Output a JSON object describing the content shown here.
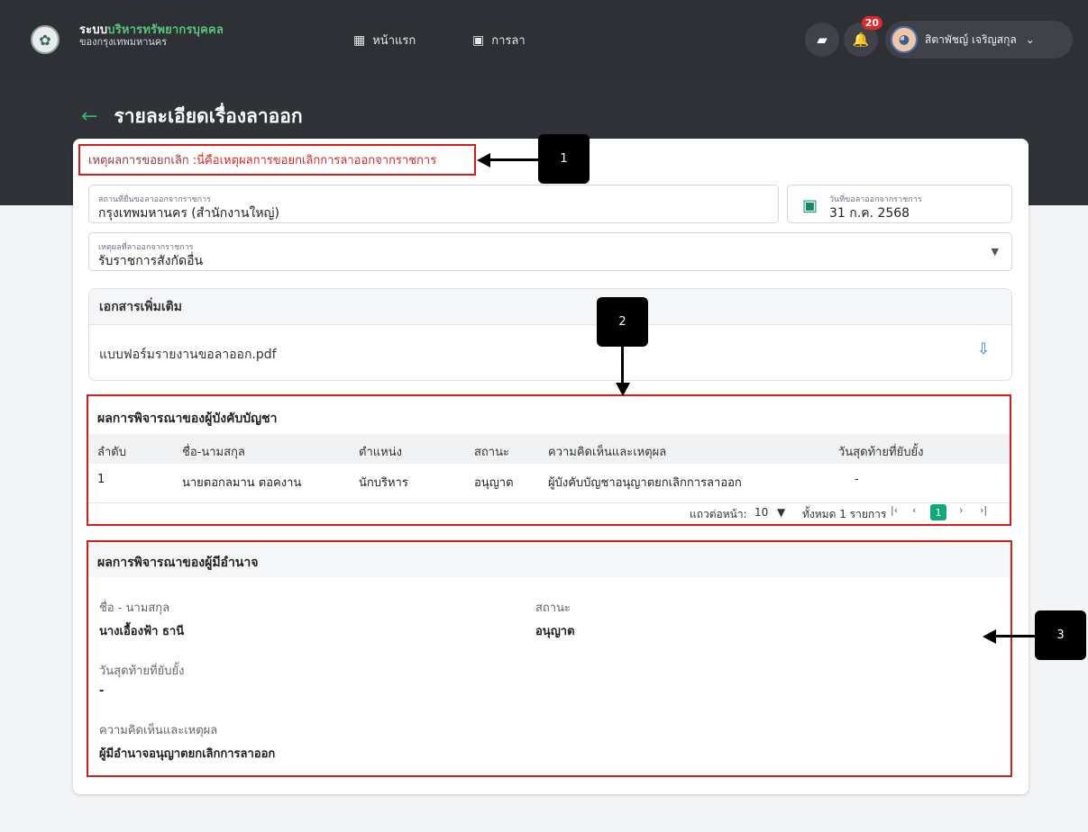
{
  "header": {
    "brand_line1_a": "ระบบ",
    "brand_line1_b": "บริหารทรัพยากรบุคคล",
    "brand_line2": "ของกรุงเทพมหานคร",
    "nav_home": "หน้าแรก",
    "nav_leave": "การลา",
    "notification_count": "20",
    "user_name": "สิตาพัชญ์ เจริญสกุล"
  },
  "page": {
    "title": "รายละเอียดเรื่องลาออก"
  },
  "cancel_reason": {
    "label": "เหตุผลการขอยกเลิก : ",
    "value": "นี่คือเหตุผลการขอยกเลิกการลาออกจากราชการ"
  },
  "fields": {
    "department_label": "สถานที่ยื่นขอลาออกจากราชการ",
    "department_value": "กรุงเทพมหานคร (สำนักงานใหญ่)",
    "date_label": "วันที่ขอลาออกจากราชการ",
    "date_value": "31 ก.ค. 2568",
    "reason_label": "เหตุผลที่ลาออกจากราชการ",
    "reason_value": "รับราชการสังกัดอื่น"
  },
  "documents": {
    "title": "เอกสารเพิ่มเติม",
    "file_name": "แบบฟอร์มรายงานขอลาออก.pdf"
  },
  "supervisor": {
    "title": "ผลการพิจารณาของผู้บังคับบัญชา",
    "columns": [
      "ลำดับ",
      "ชื่อ-นามสกุล",
      "ตำแหน่ง",
      "สถานะ",
      "ความคิดเห็นและเหตุผล",
      "วันสุดท้ายที่ยับยั้ง"
    ],
    "rows": [
      [
        "1",
        "นายตอกลมาน ตอคงาน",
        "นักบริหาร",
        "อนุญาต",
        "ผู้บังคับบัญชาอนุญาตยกเลิกการลาออก",
        "-"
      ]
    ],
    "rows_per_page_label": "แถวต่อหน้า:",
    "rows_per_page_value": "10",
    "total_label": "ทั้งหมด 1 รายการ",
    "current_page": "1"
  },
  "authority": {
    "title": "ผลการพิจารณาของผู้มีอำนาจ",
    "name_label": "ชื่อ - นามสกุล",
    "name_value": "นางเอื้องฟ้า ธานี",
    "status_label": "สถานะ",
    "status_value": "อนุญาต",
    "lastday_label": "วันสุดท้ายที่ยับยั้ง",
    "lastday_value": "-",
    "comment_label": "ความคิดเห็นและเหตุผล",
    "comment_value": "ผู้มีอำนาจอนุญาตยกเลิกการลาออก"
  },
  "callouts": {
    "one": "1",
    "two": "2",
    "three": "3"
  },
  "icons": {
    "home": "grid-icon",
    "leave": "calendar-icon",
    "book": "book-icon",
    "bell": "bell-icon",
    "back": "arrow-left-icon",
    "date": "calendar-icon",
    "download": "download-icon"
  },
  "colors": {
    "accent_green": "#11a779",
    "annotation_red": "#d71c1c",
    "topbar": "#2d3035"
  }
}
